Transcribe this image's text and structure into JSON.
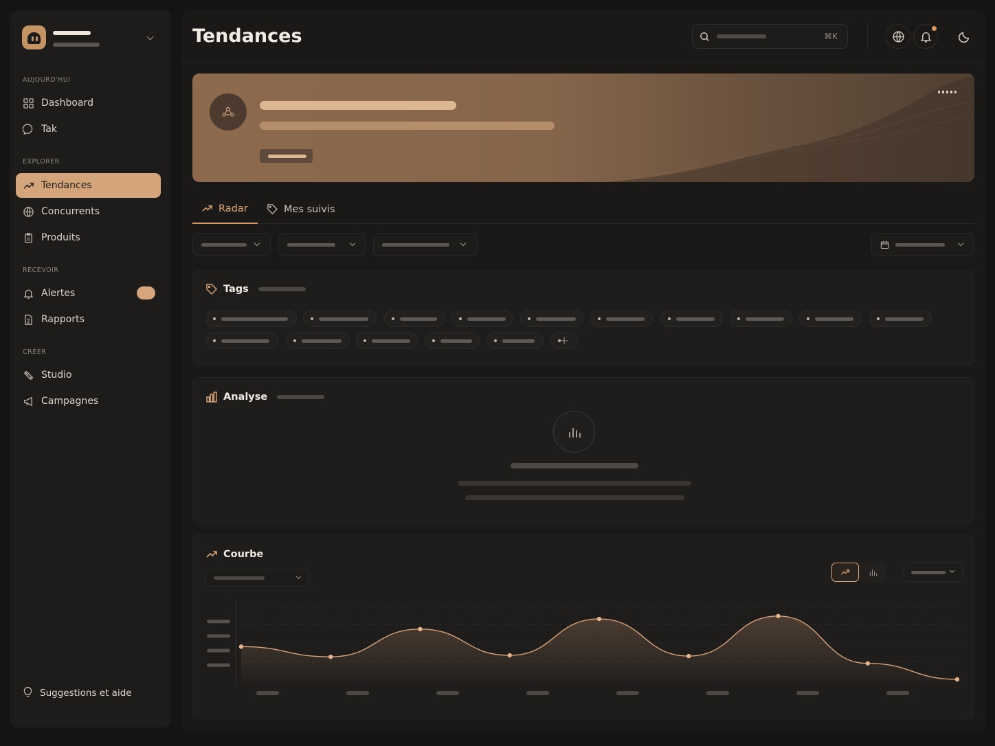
{
  "sidebar": {
    "sections": [
      {
        "label": "AUJOURD'HUI",
        "items": [
          {
            "label": "Dashboard",
            "icon": "grid-icon"
          },
          {
            "label": "Tak",
            "icon": "chat-icon"
          }
        ]
      },
      {
        "label": "EXPLORER",
        "items": [
          {
            "label": "Tendances",
            "icon": "trend-icon",
            "active": true
          },
          {
            "label": "Concurrents",
            "icon": "globe-icon"
          },
          {
            "label": "Produits",
            "icon": "clipboard-icon"
          }
        ]
      },
      {
        "label": "RECEVOIR",
        "items": [
          {
            "label": "Alertes",
            "icon": "bell-icon",
            "toggle": "on"
          },
          {
            "label": "Rapports",
            "icon": "document-icon"
          }
        ]
      },
      {
        "label": "CRÉER",
        "items": [
          {
            "label": "Studio",
            "icon": "brush-icon"
          },
          {
            "label": "Campagnes",
            "icon": "megaphone-icon"
          }
        ]
      }
    ],
    "help": "Suggestions et aide"
  },
  "header": {
    "title": "Tendances",
    "search_shortcut": "⌘K"
  },
  "tabs": [
    {
      "label": "Radar",
      "active": true
    },
    {
      "label": "Mes suivis",
      "active": false
    }
  ],
  "cards": {
    "tags": {
      "title": "Tags"
    },
    "analyse": {
      "title": "Analyse"
    },
    "courbe": {
      "title": "Courbe"
    }
  },
  "colors": {
    "accent": "#d4a57b",
    "background": "#151413",
    "panel": "#1e1d1c",
    "line": "#d8a378"
  },
  "chart_data": {
    "type": "area",
    "x": [
      1,
      2,
      3,
      4,
      5,
      6,
      7,
      8,
      9
    ],
    "values": [
      45,
      31,
      69,
      33,
      83,
      32,
      87,
      22,
      0
    ],
    "ylim": [
      0,
      100
    ],
    "grid": true,
    "xlabel": "",
    "ylabel": ""
  }
}
